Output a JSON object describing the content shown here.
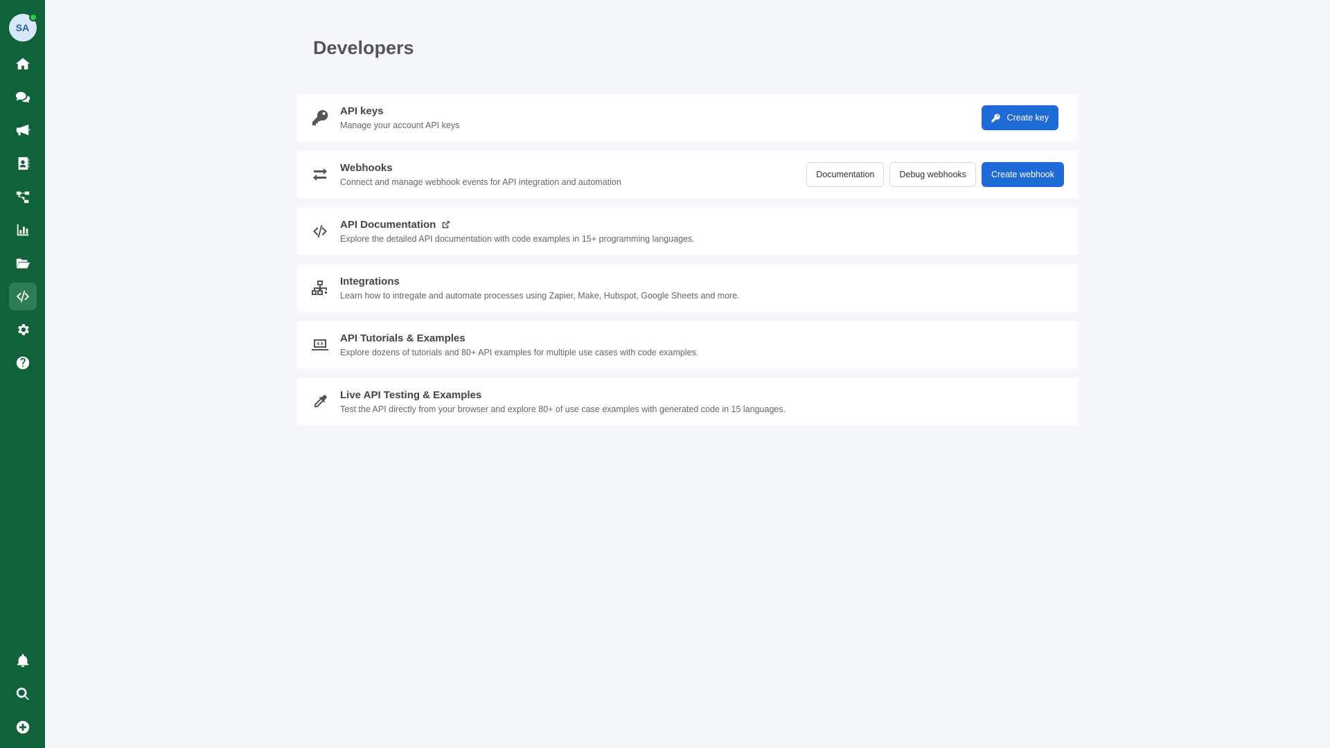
{
  "user": {
    "initials": "SA",
    "status": "online"
  },
  "sidebar": {
    "items": [
      {
        "name": "home",
        "icon": "home-icon"
      },
      {
        "name": "conversations",
        "icon": "chat-icon"
      },
      {
        "name": "campaigns",
        "icon": "megaphone-icon"
      },
      {
        "name": "contacts",
        "icon": "address-book-icon"
      },
      {
        "name": "flows",
        "icon": "flow-icon"
      },
      {
        "name": "analytics",
        "icon": "chart-icon"
      },
      {
        "name": "files",
        "icon": "folder-open-icon"
      },
      {
        "name": "developers",
        "icon": "code-icon",
        "active": true
      },
      {
        "name": "settings",
        "icon": "gear-icon"
      },
      {
        "name": "help",
        "icon": "question-icon"
      }
    ],
    "bottom": [
      {
        "name": "notifications",
        "icon": "bell-icon"
      },
      {
        "name": "search",
        "icon": "search-icon"
      },
      {
        "name": "create",
        "icon": "plus-circle-icon"
      }
    ]
  },
  "page": {
    "title": "Developers"
  },
  "cards": {
    "api_keys": {
      "title": "API keys",
      "desc": "Manage your account API keys",
      "icon": "key-icon",
      "create_key_label": "Create key"
    },
    "webhooks": {
      "title": "Webhooks",
      "desc": "Connect and manage webhook events for API integration and automation",
      "icon": "exchange-arrows-icon",
      "documentation_label": "Documentation",
      "debug_label": "Debug webhooks",
      "create_label": "Create webhook"
    },
    "api_docs": {
      "title": "API Documentation",
      "desc": "Explore the detailed API documentation with code examples in 15+ programming languages.",
      "icon": "code-icon"
    },
    "integrations": {
      "title": "Integrations",
      "desc": "Learn how to intregate and automate processes using Zapier, Make, Hubspot, Google Sheets and more.",
      "icon": "network-icon"
    },
    "tutorials": {
      "title": "API Tutorials & Examples",
      "desc": "Explore dozens of tutorials and 80+ API examples for multiple use cases with code examples.",
      "icon": "laptop-code-icon"
    },
    "live_testing": {
      "title": "Live API Testing & Examples",
      "desc": "Test the API directly from your browser and explore 80+ of use case examples with generated code in 15 languages.",
      "icon": "eyedropper-icon"
    }
  },
  "colors": {
    "sidebar_bg": "#10623a",
    "sidebar_active": "#2e7d55",
    "primary": "#1e6ad6",
    "page_bg": "#f6f7fb"
  }
}
